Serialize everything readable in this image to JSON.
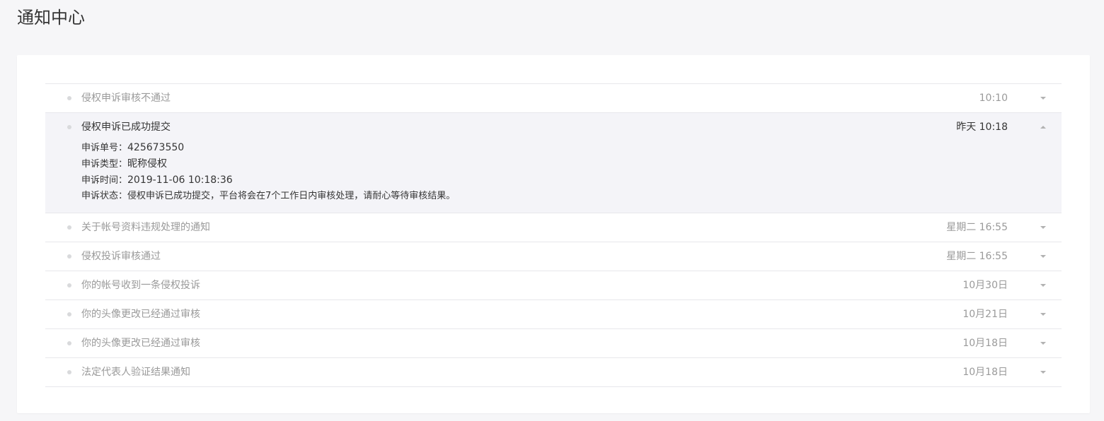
{
  "page": {
    "title": "通知中心"
  },
  "notifications": [
    {
      "title": "侵权申诉审核不通过",
      "time": "10:10",
      "expanded": false
    },
    {
      "title": "侵权申诉已成功提交",
      "time": "昨天 10:18",
      "expanded": true,
      "details": [
        {
          "label": "申诉单号：",
          "value": "425673550"
        },
        {
          "label": "申诉类型：",
          "value": "昵称侵权"
        },
        {
          "label": "申诉时间：",
          "value": "2019-11-06 10:18:36"
        },
        {
          "label": "申诉状态：",
          "value": "侵权申诉已成功提交，平台将会在7个工作日内审核处理，请耐心等待审核结果。"
        }
      ]
    },
    {
      "title": "关于帐号资料违规处理的通知",
      "time": "星期二 16:55",
      "expanded": false
    },
    {
      "title": "侵权投诉审核通过",
      "time": "星期二 16:55",
      "expanded": false
    },
    {
      "title": "你的帐号收到一条侵权投诉",
      "time": "10月30日",
      "expanded": false
    },
    {
      "title": "你的头像更改已经通过审核",
      "time": "10月21日",
      "expanded": false
    },
    {
      "title": "你的头像更改已经通过审核",
      "time": "10月18日",
      "expanded": false
    },
    {
      "title": "法定代表人验证结果通知",
      "time": "10月18日",
      "expanded": false
    }
  ],
  "icons": {
    "bullet": "dot-icon",
    "expand": "caret-down-icon",
    "collapse": "caret-up-icon"
  },
  "colors": {
    "page_bg": "#f6f6f8",
    "card_bg": "#ffffff",
    "expanded_bg": "#f4f4f8",
    "muted_text": "#9a9a9a",
    "primary_text": "#353535"
  }
}
